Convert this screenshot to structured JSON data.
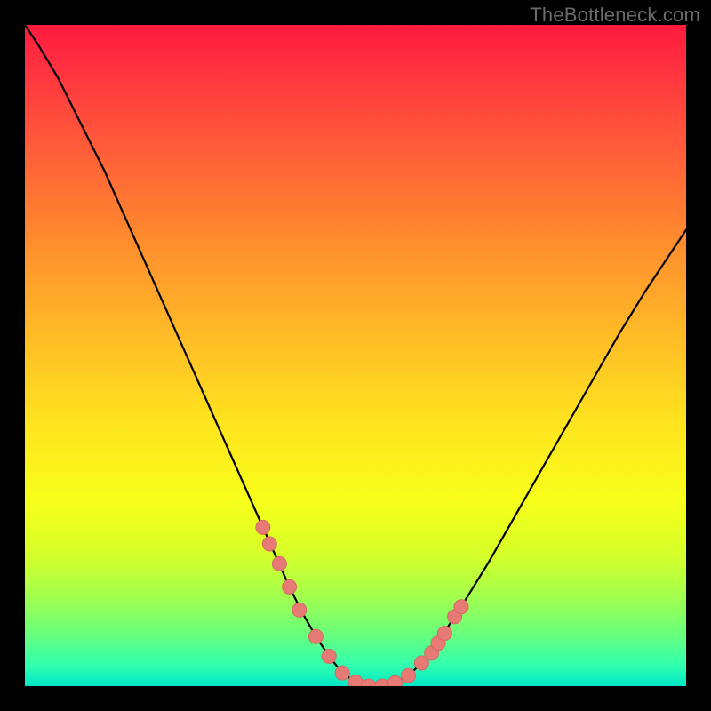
{
  "watermark": "TheBottleneck.com",
  "colors": {
    "curve": "#000000",
    "marker_fill": "#e77a74",
    "marker_stroke": "#d46a64"
  },
  "chart_data": {
    "type": "line",
    "title": "",
    "xlabel": "",
    "ylabel": "",
    "xlim": [
      0,
      100
    ],
    "ylim": [
      0,
      100
    ],
    "grid": false,
    "series": [
      {
        "name": "bottleneck-curve",
        "x": [
          0,
          2,
          5,
          8,
          12,
          16,
          20,
          24,
          28,
          32,
          36,
          38,
          40,
          42,
          44,
          46,
          48,
          50,
          52,
          54,
          56,
          58,
          60,
          62,
          66,
          70,
          74,
          78,
          82,
          86,
          90,
          94,
          98,
          100
        ],
        "y": [
          100,
          97,
          92,
          86,
          78,
          69,
          60,
          51,
          42,
          33,
          24,
          19.5,
          15,
          11,
          7.5,
          4.5,
          2,
          0.6,
          0,
          0,
          0.5,
          1.6,
          3.5,
          6,
          12,
          18.5,
          25.5,
          32.5,
          39.5,
          46.5,
          53.5,
          60,
          66,
          69
        ]
      }
    ],
    "markers": {
      "name": "highlight-points",
      "x": [
        36,
        37,
        38.5,
        40,
        41.5,
        44,
        46,
        48,
        50,
        52,
        54,
        56,
        58,
        60,
        61.5,
        62.5,
        63.5,
        65,
        66
      ],
      "y": [
        24,
        21.5,
        18.5,
        15,
        11.5,
        7.5,
        4.5,
        2,
        0.6,
        0,
        0,
        0.5,
        1.6,
        3.5,
        5,
        6.5,
        8,
        10.5,
        12
      ]
    }
  }
}
